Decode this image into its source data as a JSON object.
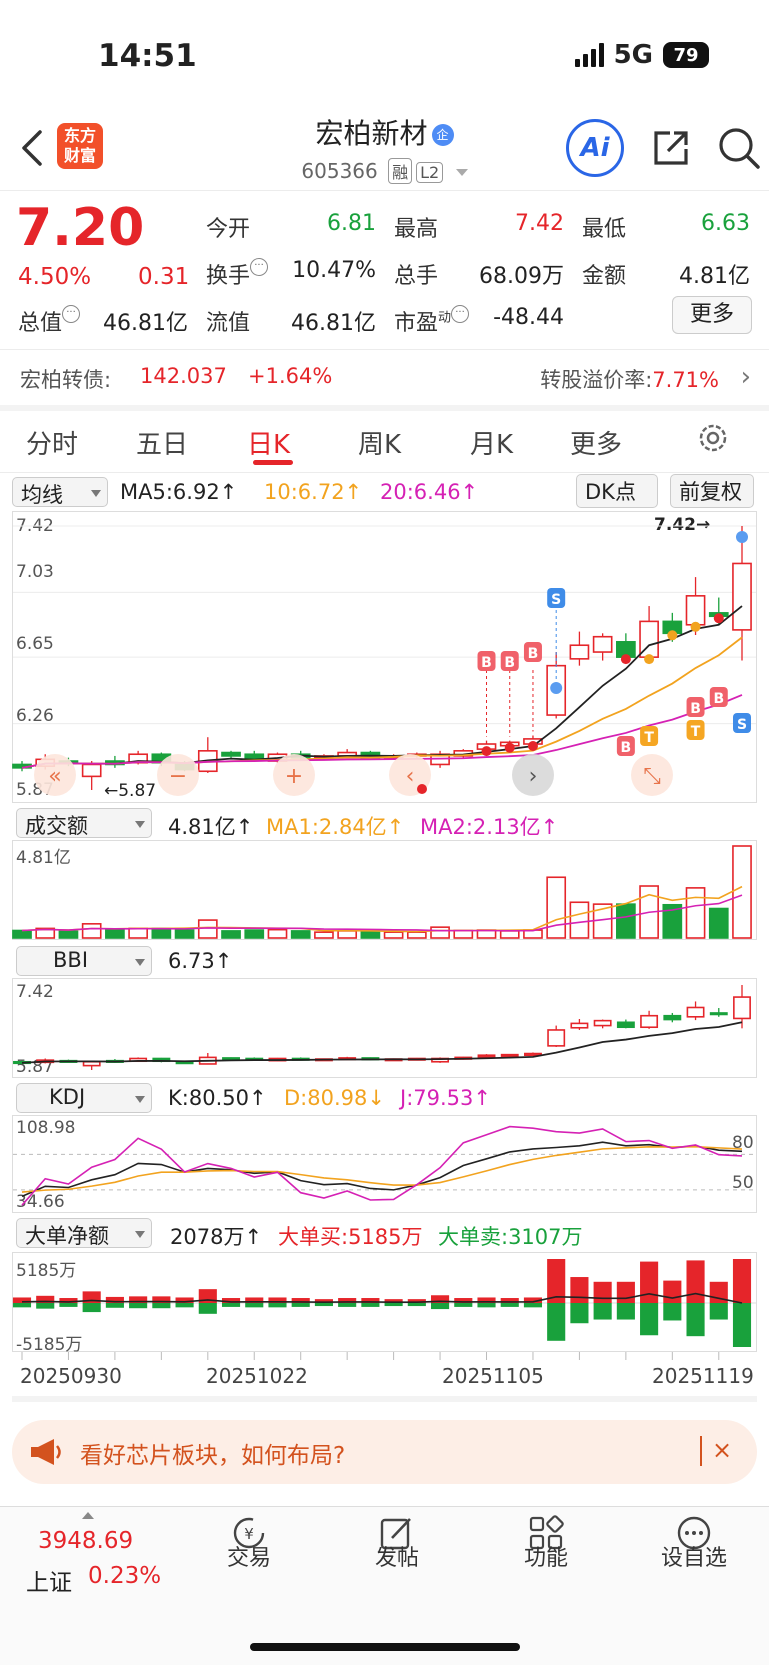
{
  "status_bar": {
    "time": "14:51",
    "network": "5G",
    "battery": "79"
  },
  "header": {
    "app_logo": "东方\n财富",
    "stock_name": "宏柏新材",
    "name_badge": "企",
    "stock_code": "605366",
    "tag_rong": "融",
    "tag_level": "L2",
    "ai_label": "Ai"
  },
  "quote": {
    "price": "7.20",
    "change_pct": "4.50%",
    "change_val": "0.31",
    "open_label": "今开",
    "open": "6.81",
    "high_label": "最高",
    "high": "7.42",
    "low_label": "最低",
    "low": "6.63",
    "turnover_label": "换手",
    "turnover": "10.47%",
    "volume_label": "总手",
    "volume": "68.09万",
    "amount_label": "金额",
    "amount": "4.81亿",
    "mktcap_label": "总值",
    "mktcap": "46.81亿",
    "float_label": "流值",
    "float": "46.81亿",
    "pe_label": "市盈",
    "pe_sup": "动",
    "pe": "-48.44",
    "more_label": "更多"
  },
  "bond": {
    "label": "宏柏转债:",
    "price": "142.037",
    "change": "+1.64%",
    "premium_label": "转股溢价率:",
    "premium": "7.71%"
  },
  "tabs": [
    {
      "label": "分时"
    },
    {
      "label": "五日"
    },
    {
      "label": "日K"
    },
    {
      "label": "周K"
    },
    {
      "label": "月K"
    },
    {
      "label": "更多"
    }
  ],
  "ma_row": {
    "selector": "均线",
    "ma5": "MA5:6.92↑",
    "ma10": "10:6.72↑",
    "ma20": "20:6.46↑",
    "dk_label": "DK点",
    "adjust_label": "前复权"
  },
  "kline_axis": {
    "top": "7.42",
    "mid1": "7.03",
    "mid2": "6.65",
    "mid3": "6.26",
    "bottom": "5.87",
    "max_marker": "7.42→",
    "min_marker": "←5.87"
  },
  "vol_row": {
    "selector": "成交额",
    "val": "4.81亿↑",
    "ma1": "MA1:2.84亿↑",
    "ma2": "MA2:2.13亿↑",
    "axis_top": "4.81亿"
  },
  "bbi_row": {
    "selector": "BBI",
    "val": "6.73↑",
    "axis_top": "7.42",
    "axis_bottom": "5.87"
  },
  "kdj_row": {
    "selector": "KDJ",
    "k": "K:80.50↑",
    "d": "D:80.98↓",
    "j": "J:79.53↑",
    "axis_top": "108.98",
    "axis_bottom": "34.66",
    "level_80": "80",
    "level_50": "50"
  },
  "flow_row": {
    "selector": "大单净额",
    "val": "2078万↑",
    "buy": "大单买:5185万",
    "sell": "大单卖:3107万",
    "axis_top": "5185万",
    "axis_bottom": "-5185万"
  },
  "dates": [
    "20250930",
    "20251022",
    "20251105",
    "20251119"
  ],
  "promo": {
    "text": "看好芯片板块，如何布局?",
    "close": "×"
  },
  "bottom_nav": {
    "index_value": "3948.69",
    "index_name": "上证",
    "index_pct": "0.23%",
    "items": [
      {
        "label": "交易"
      },
      {
        "label": "发帖"
      },
      {
        "label": "功能"
      },
      {
        "label": "设自选"
      }
    ]
  },
  "colors": {
    "up": "#e5252a",
    "down": "#19a13c",
    "ma10": "#f2a31f",
    "ma20": "#d521b4"
  },
  "chart_data": {
    "type": "candlestick",
    "ylim": [
      5.87,
      7.42
    ],
    "candles": [
      {
        "o": 6.02,
        "c": 6.0,
        "h": 6.04,
        "l": 5.98
      },
      {
        "o": 6.01,
        "c": 6.05,
        "h": 6.08,
        "l": 5.99
      },
      {
        "o": 6.04,
        "c": 6.03,
        "h": 6.06,
        "l": 6.01
      },
      {
        "o": 5.95,
        "c": 6.02,
        "h": 6.04,
        "l": 5.87
      },
      {
        "o": 6.04,
        "c": 6.02,
        "h": 6.07,
        "l": 6.0
      },
      {
        "o": 6.03,
        "c": 6.08,
        "h": 6.1,
        "l": 6.02
      },
      {
        "o": 6.08,
        "c": 6.03,
        "h": 6.09,
        "l": 6.01
      },
      {
        "o": 6.02,
        "c": 5.99,
        "h": 6.04,
        "l": 5.98
      },
      {
        "o": 5.98,
        "c": 6.1,
        "h": 6.18,
        "l": 5.97
      },
      {
        "o": 6.09,
        "c": 6.07,
        "h": 6.1,
        "l": 6.05
      },
      {
        "o": 6.08,
        "c": 6.05,
        "h": 6.1,
        "l": 6.04
      },
      {
        "o": 6.04,
        "c": 6.08,
        "h": 6.09,
        "l": 6.03
      },
      {
        "o": 6.08,
        "c": 6.06,
        "h": 6.1,
        "l": 6.05
      },
      {
        "o": 6.06,
        "c": 6.07,
        "h": 6.08,
        "l": 6.05
      },
      {
        "o": 6.07,
        "c": 6.09,
        "h": 6.11,
        "l": 6.06
      },
      {
        "o": 6.09,
        "c": 6.06,
        "h": 6.1,
        "l": 6.05
      },
      {
        "o": 6.06,
        "c": 6.07,
        "h": 6.08,
        "l": 6.05
      },
      {
        "o": 6.07,
        "c": 6.08,
        "h": 6.09,
        "l": 6.06
      },
      {
        "o": 6.02,
        "c": 6.08,
        "h": 6.1,
        "l": 6.0
      },
      {
        "o": 6.07,
        "c": 6.1,
        "h": 6.11,
        "l": 6.06
      },
      {
        "o": 6.11,
        "c": 6.14,
        "h": 6.16,
        "l": 6.1
      },
      {
        "o": 6.13,
        "c": 6.15,
        "h": 6.16,
        "l": 6.11
      },
      {
        "o": 6.14,
        "c": 6.17,
        "h": 6.19,
        "l": 6.13
      },
      {
        "o": 6.31,
        "c": 6.6,
        "h": 6.68,
        "l": 6.29
      },
      {
        "o": 6.64,
        "c": 6.72,
        "h": 6.8,
        "l": 6.6
      },
      {
        "o": 6.68,
        "c": 6.77,
        "h": 6.79,
        "l": 6.63
      },
      {
        "o": 6.74,
        "c": 6.65,
        "h": 6.79,
        "l": 6.63
      },
      {
        "o": 6.65,
        "c": 6.86,
        "h": 6.95,
        "l": 6.62
      },
      {
        "o": 6.86,
        "c": 6.79,
        "h": 6.91,
        "l": 6.74
      },
      {
        "o": 6.84,
        "c": 7.01,
        "h": 7.12,
        "l": 6.78
      },
      {
        "o": 6.91,
        "c": 6.89,
        "h": 7.0,
        "l": 6.84
      },
      {
        "o": 6.81,
        "c": 7.2,
        "h": 7.42,
        "l": 6.63
      }
    ]
  }
}
